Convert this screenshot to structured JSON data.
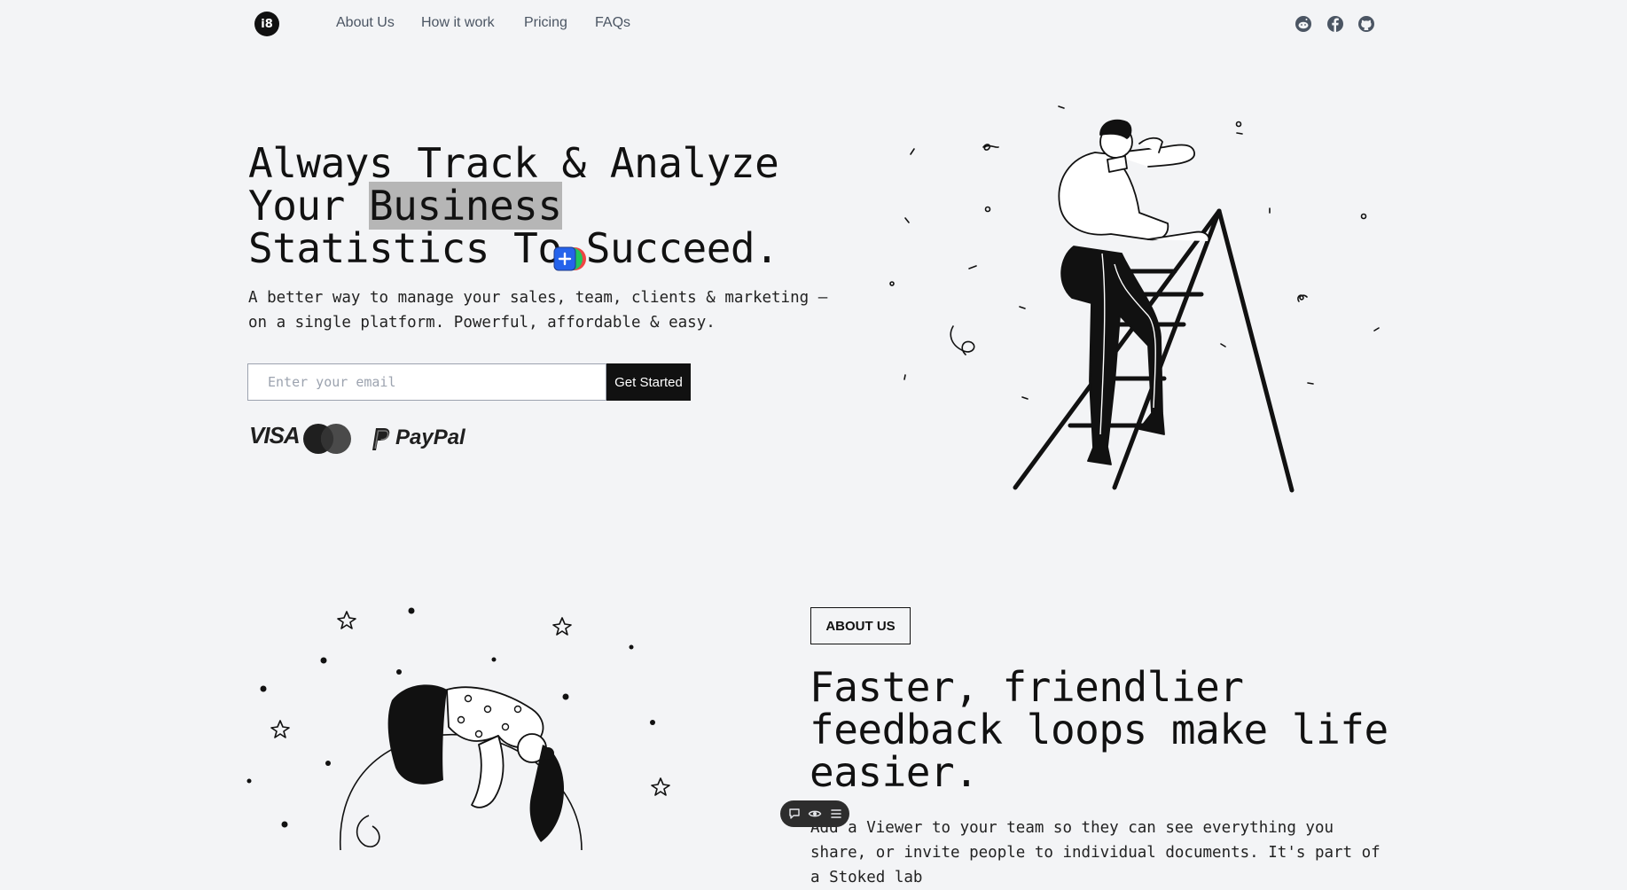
{
  "nav": {
    "logo_text": "i8",
    "links": [
      "About Us",
      "How it work",
      "Pricing",
      "FAQs"
    ],
    "social_icons": [
      "reddit-icon",
      "facebook-icon",
      "github-icon"
    ]
  },
  "hero": {
    "title_before": "Always Track & Analyze Your ",
    "title_highlight": "Business",
    "title_after": " Statistics To Succeed.",
    "subtitle": "A better way to manage your sales, team, clients & marketing — on a single platform. Powerful, affordable & easy.",
    "email_placeholder": "Enter your email",
    "email_value": "",
    "cta_label": "Get Started",
    "payments": {
      "visa": "VISA",
      "mastercard": "mastercard-icon",
      "paypal": "PayPal"
    }
  },
  "about": {
    "tag": "ABOUT US",
    "title": "Faster, friendlier feedback loops make life easier.",
    "subtitle": "Add a Viewer to your team so they can see everything you share, or invite people to individual documents. It's part of a Stoked lab"
  },
  "colors": {
    "background": "#f3f4f6",
    "primary": "#111111",
    "muted_text": "#4b5563",
    "highlight": "#b6b6b6"
  }
}
